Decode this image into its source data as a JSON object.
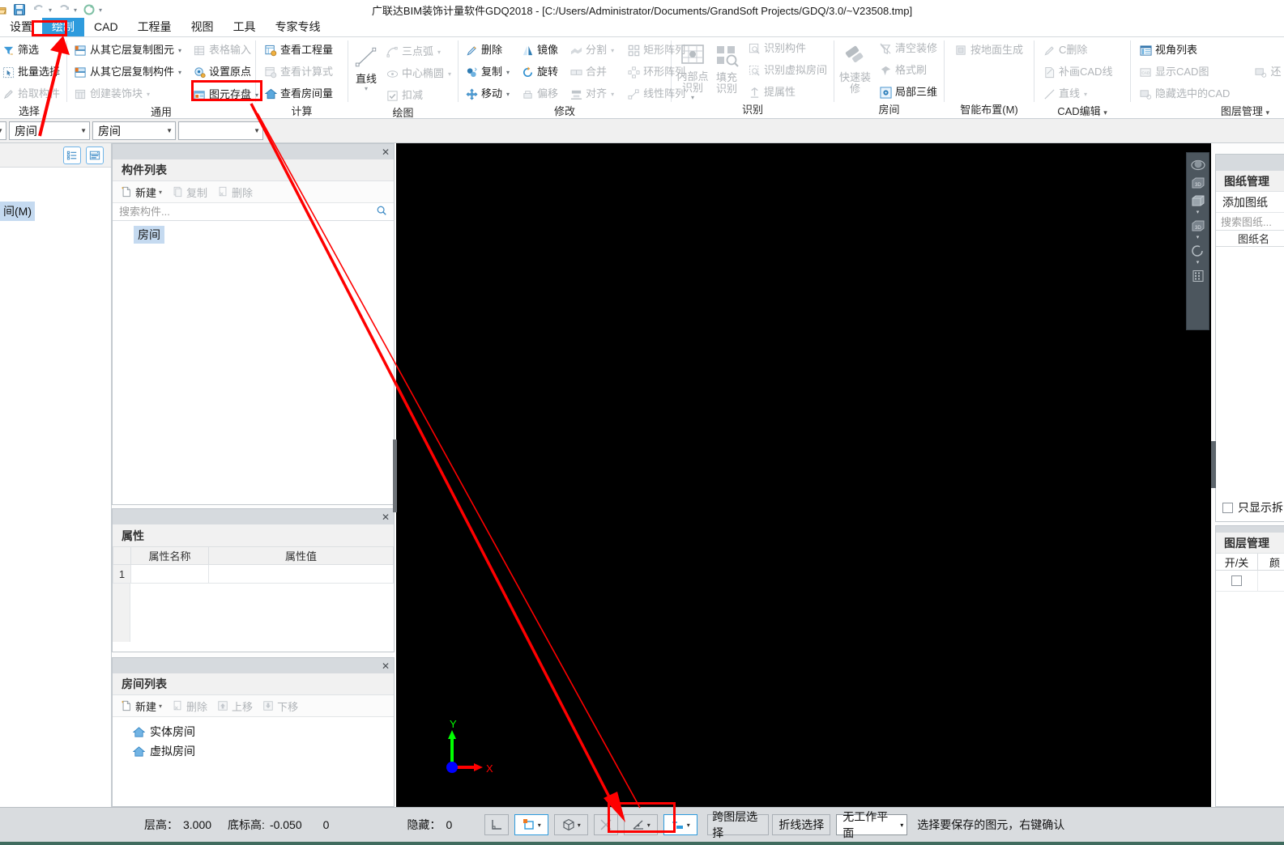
{
  "window": {
    "title": "广联达BIM装饰计量软件GDQ2018 - [C:/Users/Administrator/Documents/GrandSoft Projects/GDQ/3.0/~V23508.tmp]"
  },
  "quick_access": {
    "icons": [
      "open-icon",
      "save-icon",
      "undo-icon",
      "redo-icon",
      "refresh-icon",
      "customize-icon"
    ]
  },
  "menu_tabs": [
    {
      "label": "设置",
      "active": false
    },
    {
      "label": "绘制",
      "active": true
    },
    {
      "label": "CAD",
      "active": false
    },
    {
      "label": "工程量",
      "active": false
    },
    {
      "label": "视图",
      "active": false
    },
    {
      "label": "工具",
      "active": false
    },
    {
      "label": "专家专线",
      "active": false
    }
  ],
  "ribbon": {
    "groups": [
      {
        "title": "选择",
        "items": [
          {
            "label": "筛选",
            "icon": "filter-icon",
            "disabled": false,
            "dropdown": false
          },
          {
            "label": "批量选择",
            "icon": "batch-select-icon",
            "disabled": false,
            "dropdown": false
          },
          {
            "label": "拾取构件",
            "icon": "pick-component-icon",
            "disabled": true,
            "dropdown": false
          }
        ]
      },
      {
        "title": "通用",
        "items": [
          {
            "label": "从其它层复制图元",
            "icon": "copy-layer-element-icon",
            "disabled": false,
            "dropdown": true
          },
          {
            "label": "从其它层复制构件",
            "icon": "copy-layer-component-icon",
            "disabled": false,
            "dropdown": true
          },
          {
            "label": "创建装饰块",
            "icon": "create-decor-block-icon",
            "disabled": true,
            "dropdown": true
          },
          {
            "label": "表格输入",
            "icon": "table-input-icon",
            "disabled": true,
            "dropdown": false
          },
          {
            "label": "设置原点",
            "icon": "set-origin-icon",
            "disabled": false,
            "dropdown": false
          },
          {
            "label": "图元存盘",
            "icon": "element-save-icon",
            "disabled": false,
            "dropdown": true,
            "highlight": true
          }
        ]
      },
      {
        "title": "计算",
        "items": [
          {
            "label": "查看工程量",
            "icon": "view-quantity-icon",
            "disabled": false,
            "dropdown": false
          },
          {
            "label": "查看计算式",
            "icon": "view-formula-icon",
            "disabled": true,
            "dropdown": false
          },
          {
            "label": "查看房间量",
            "icon": "view-room-quantity-icon",
            "disabled": false,
            "dropdown": false
          }
        ]
      },
      {
        "title": "绘图",
        "items": [
          {
            "label": "直线",
            "icon": "line-icon",
            "disabled": false,
            "dropdown": true,
            "big": true
          },
          {
            "label": "三点弧",
            "icon": "three-point-arc-icon",
            "disabled": true,
            "dropdown": true
          },
          {
            "label": "中心椭圆",
            "icon": "center-ellipse-icon",
            "disabled": true,
            "dropdown": true
          },
          {
            "label": "扣减",
            "icon": "deduct-checkbox-icon",
            "disabled": true,
            "dropdown": false
          }
        ]
      },
      {
        "title": "修改",
        "items": [
          {
            "label": "删除",
            "icon": "delete-icon",
            "disabled": false,
            "dropdown": false
          },
          {
            "label": "复制",
            "icon": "copy-icon",
            "disabled": false,
            "dropdown": true
          },
          {
            "label": "移动",
            "icon": "move-icon",
            "disabled": false,
            "dropdown": true
          },
          {
            "label": "镜像",
            "icon": "mirror-icon",
            "disabled": false,
            "dropdown": false
          },
          {
            "label": "旋转",
            "icon": "rotate-icon",
            "disabled": false,
            "dropdown": false
          },
          {
            "label": "偏移",
            "icon": "offset-icon",
            "disabled": true,
            "dropdown": false
          },
          {
            "label": "分割",
            "icon": "split-icon",
            "disabled": true,
            "dropdown": true
          },
          {
            "label": "合并",
            "icon": "merge-icon",
            "disabled": true,
            "dropdown": false
          },
          {
            "label": "对齐",
            "icon": "align-icon",
            "disabled": true,
            "dropdown": true
          },
          {
            "label": "矩形阵列",
            "icon": "rect-array-icon",
            "disabled": true,
            "dropdown": false
          },
          {
            "label": "环形阵列",
            "icon": "polar-array-icon",
            "disabled": true,
            "dropdown": false
          },
          {
            "label": "线性阵列",
            "icon": "linear-array-icon",
            "disabled": true,
            "dropdown": false
          }
        ]
      },
      {
        "title": "识别",
        "items": [
          {
            "label": "内部点识别",
            "icon": "inner-point-recognize-icon",
            "disabled": true,
            "dropdown": true,
            "big": true
          },
          {
            "label": "填充识别",
            "icon": "fill-recognize-icon",
            "disabled": true,
            "dropdown": false,
            "big": true
          },
          {
            "label": "识别构件",
            "icon": "recognize-component-icon",
            "disabled": true,
            "dropdown": false
          },
          {
            "label": "识别虚拟房间",
            "icon": "recognize-virtual-room-icon",
            "disabled": true,
            "dropdown": false
          },
          {
            "label": "提属性",
            "icon": "extract-property-icon",
            "disabled": true,
            "dropdown": false
          }
        ]
      },
      {
        "title": "房间",
        "items": [
          {
            "label": "快速装修",
            "icon": "quick-decorate-icon",
            "disabled": true,
            "dropdown": false,
            "big": true
          },
          {
            "label": "清空装修",
            "icon": "clear-decorate-icon",
            "disabled": true,
            "dropdown": false
          },
          {
            "label": "格式刷",
            "icon": "format-brush-icon",
            "disabled": true,
            "dropdown": false
          },
          {
            "label": "局部三维",
            "icon": "local-3d-icon",
            "disabled": false,
            "dropdown": false
          }
        ]
      },
      {
        "title": "智能布置(M)",
        "items": [
          {
            "label": "按地面生成",
            "icon": "generate-by-floor-icon",
            "disabled": true,
            "dropdown": false
          }
        ]
      },
      {
        "title": "CAD编辑",
        "dropdown": true,
        "items": [
          {
            "label": "C删除",
            "icon": "cad-delete-icon",
            "disabled": true,
            "dropdown": false
          },
          {
            "label": "补画CAD线",
            "icon": "draw-cad-line-icon",
            "disabled": true,
            "dropdown": false
          },
          {
            "label": "直线",
            "icon": "cad-line-icon",
            "disabled": true,
            "dropdown": true
          }
        ]
      },
      {
        "title": "图层管理",
        "dropdown": true,
        "items": [
          {
            "label": "视角列表",
            "icon": "view-list-icon",
            "disabled": false,
            "dropdown": false
          },
          {
            "label": "显示CAD图",
            "icon": "show-cad-icon",
            "disabled": true,
            "dropdown": false
          },
          {
            "label": "隐藏选中的CAD",
            "icon": "hide-selected-cad-icon",
            "disabled": true,
            "dropdown": false
          },
          {
            "label": "还",
            "icon": "restore-cad-icon",
            "disabled": true,
            "dropdown": false
          }
        ]
      }
    ]
  },
  "combobar": {
    "combos": [
      {
        "value": "",
        "name": "floor-combo"
      },
      {
        "value": "房间",
        "name": "category-combo"
      },
      {
        "value": "房间",
        "name": "component-type-combo"
      },
      {
        "value": "",
        "name": "component-combo"
      }
    ]
  },
  "left_strip": {
    "view_buttons": [
      "list-view-icon",
      "detail-view-icon"
    ],
    "item_label": "间(M)"
  },
  "component_panel": {
    "title": "构件列表",
    "tools": [
      {
        "label": "新建",
        "icon": "new-icon",
        "disabled": false,
        "dropdown": true
      },
      {
        "label": "复制",
        "icon": "copy-doc-icon",
        "disabled": true,
        "dropdown": false
      },
      {
        "label": "删除",
        "icon": "delete-doc-icon",
        "disabled": true,
        "dropdown": false
      }
    ],
    "search_placeholder": "搜索构件...",
    "search_icon": "search-icon",
    "tree_items": [
      "房间"
    ]
  },
  "property_panel": {
    "title": "属性",
    "columns": [
      "",
      "属性名称",
      "属性值"
    ],
    "rows": [
      {
        "num": "1",
        "name": "",
        "value": ""
      }
    ]
  },
  "room_panel": {
    "title": "房间列表",
    "tools": [
      {
        "label": "新建",
        "icon": "new-icon",
        "disabled": false,
        "dropdown": true
      },
      {
        "label": "删除",
        "icon": "delete-doc-icon",
        "disabled": true,
        "dropdown": false
      },
      {
        "label": "上移",
        "icon": "move-up-icon",
        "disabled": true,
        "dropdown": false
      },
      {
        "label": "下移",
        "icon": "move-down-icon",
        "disabled": true,
        "dropdown": false
      }
    ],
    "items": [
      {
        "label": "实体房间",
        "icon": "house-icon"
      },
      {
        "label": "虚拟房间",
        "icon": "house-icon"
      }
    ]
  },
  "canvas": {
    "background": "#000000",
    "axis": {
      "x_label": "X",
      "y_label": "Y",
      "x_color": "#ff0000",
      "y_color": "#00ff00",
      "origin_color": "#0000ff"
    },
    "view_tools": [
      "orbit-icon",
      "view-3d-icon",
      "box-view-icon",
      "3d-view-icon",
      "rotate-view-icon",
      "grid-view-icon"
    ]
  },
  "drawing_panel": {
    "title": "图纸管理",
    "add_label": "添加图纸",
    "search_placeholder": "搜索图纸...",
    "column_header": "图纸名",
    "checkbox_label": "只显示拆"
  },
  "layer_panel": {
    "title": "图层管理",
    "columns": [
      "开/关",
      "颜"
    ]
  },
  "statusbar": {
    "floor_height_label": "层高：",
    "floor_height_value": "3.000",
    "base_elev_label": "底标高:",
    "base_elev_value": "-0.050",
    "extra_value": "0",
    "hidden_label": "隐藏：",
    "hidden_value": "0",
    "tool_buttons": [
      {
        "name": "ortho-icon",
        "active": false,
        "dropdown": false
      },
      {
        "name": "rect-snap-icon",
        "active": true,
        "dropdown": true
      },
      {
        "name": "3d-snap-icon",
        "active": false,
        "dropdown": true
      },
      {
        "name": "intersect-snap-icon",
        "active": false,
        "dropdown": false
      },
      {
        "name": "angle-snap-icon",
        "active": false,
        "dropdown": true
      },
      {
        "name": "add-point-icon",
        "active": true,
        "dropdown": true
      }
    ],
    "cross_layer_select": "跨图层选择",
    "polyline_select": "折线选择",
    "work_plane": "无工作平面",
    "hint": "选择要保存的图元，右键确认"
  },
  "annotations": {
    "arrow_color": "#fe0000",
    "highlight_boxes": [
      "绘制",
      "图元存盘",
      "跨图层选择"
    ]
  }
}
